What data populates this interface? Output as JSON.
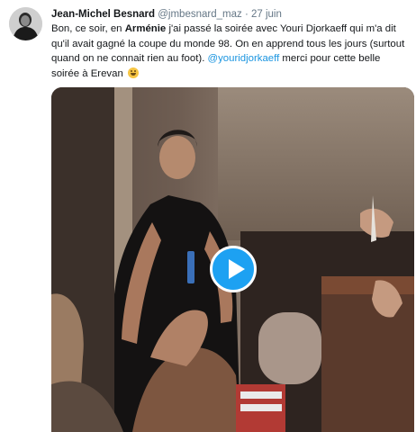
{
  "tweet": {
    "author_name": "Jean-Michel Besnard",
    "handle": "@jmbesnard_maz",
    "separator": "·",
    "date": "27 juin",
    "text_part1": "Bon, ce soir, en ",
    "text_bold": "Arménie",
    "text_part2": " j'ai passé la soirée avec Youri Djorkaeff qui m'a dit qu'il avait gagné la coupe du monde 98. On en apprend tous les jours (surtout quand on ne connait rien au foot). ",
    "mention": "@youridjorkaeff",
    "text_part3": " merci pour cette belle soirée à Erevan",
    "emoji": "grinning-face-emoji"
  },
  "media": {
    "type": "video",
    "play_icon": "play-icon",
    "accent_color": "#1da1f2"
  }
}
